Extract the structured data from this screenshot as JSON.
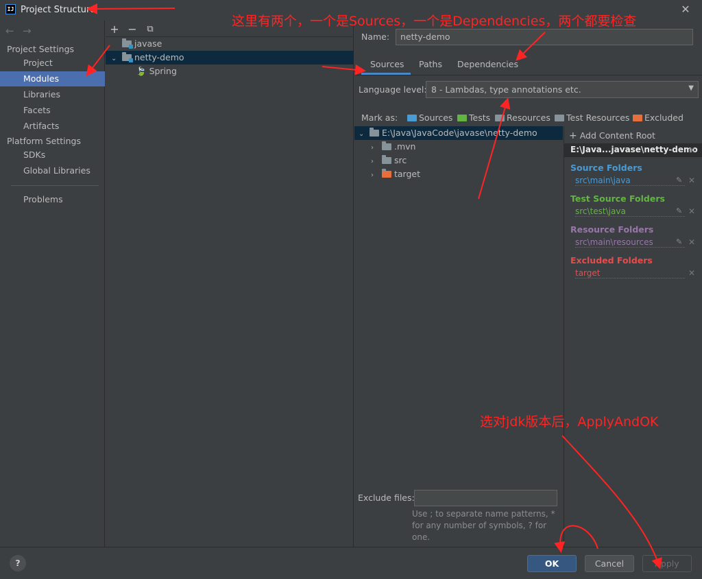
{
  "window": {
    "title": "Project Structure",
    "app_icon": "IJ"
  },
  "sidebar": {
    "project_settings": "Project Settings",
    "items_project": [
      "Project",
      "Modules",
      "Libraries",
      "Facets",
      "Artifacts"
    ],
    "platform_settings": "Platform Settings",
    "items_platform": [
      "SDKs",
      "Global Libraries"
    ],
    "problems": "Problems",
    "selected": "Modules"
  },
  "modules_tree": {
    "rows": [
      {
        "label": "javase"
      },
      {
        "label": "netty-demo"
      },
      {
        "label": "Spring"
      }
    ]
  },
  "module": {
    "name_label": "Name:",
    "name_value": "netty-demo",
    "tabs": [
      "Sources",
      "Paths",
      "Dependencies"
    ],
    "active_tab": "Sources",
    "language_level_label": "Language level:",
    "language_level_value": "8 - Lambdas, type annotations etc.",
    "mark_as_label": "Mark as:",
    "mark_as": [
      "Sources",
      "Tests",
      "Resources",
      "Test Resources",
      "Excluded"
    ]
  },
  "content_tree": {
    "root": "E:\\Java\\JavaCode\\javase\\netty-demo",
    "children": [
      ".mvn",
      "src",
      "target"
    ]
  },
  "content_roots": {
    "add_label": "Add Content Root",
    "root_path": "E:\\Java...javase\\netty-demo",
    "source_folders_head": "Source Folders",
    "source_folders_path": "src\\main\\java",
    "test_source_head": "Test Source Folders",
    "test_source_path": "src\\test\\java",
    "resource_head": "Resource Folders",
    "resource_path": "src\\main\\resources",
    "excluded_head": "Excluded Folders",
    "excluded_path": "target"
  },
  "exclude": {
    "label": "Exclude files:",
    "value": "",
    "hint_1": "Use ; to separate name patterns, *",
    "hint_2": "for any number of symbols, ? for",
    "hint_3": "one."
  },
  "footer": {
    "help": "?",
    "ok": "OK",
    "cancel": "Cancel",
    "apply": "Apply"
  },
  "annotations": {
    "top_note": "这里有两个，一个是Sources，一个是Dependencies，两个都要检查",
    "bottom_note": "选对jdk版本后，ApplyAndOK"
  },
  "colors": {
    "sources": "#4a9ad4",
    "tests": "#62b543",
    "resources": "#9876aa",
    "excluded": "#e76f3c",
    "annotation": "#ff2424"
  }
}
